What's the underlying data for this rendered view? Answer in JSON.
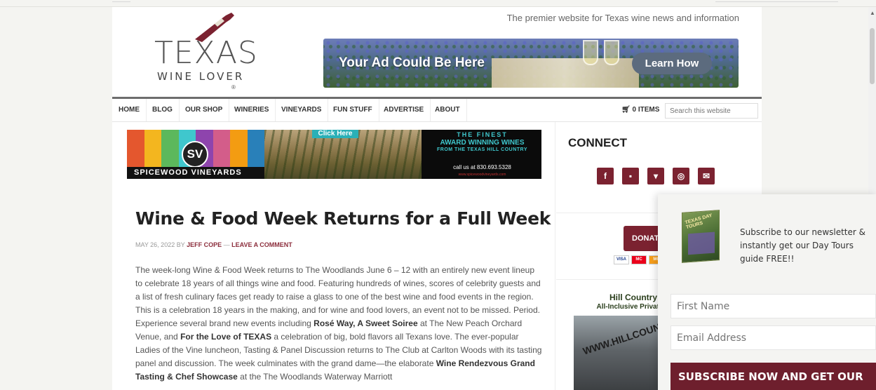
{
  "header": {
    "logo": {
      "line1": "TEXAS",
      "line2": "WINE LOVER",
      "reg": "®"
    },
    "tagline": "The premier website for Texas wine news and information",
    "ad": {
      "title": "Your Ad Could Be Here",
      "button": "Learn How"
    }
  },
  "nav": {
    "items": [
      "HOME",
      "BLOG",
      "OUR SHOP",
      "WINERIES",
      "VINEYARDS",
      "FUN STUFF",
      "ADVERTISE",
      "ABOUT"
    ],
    "cart_label": "0 ITEMS",
    "search_placeholder": "Search this website"
  },
  "sv_ad": {
    "logo": "SV",
    "name": "SPICEWOOD VINEYARDS",
    "click": "Click Here",
    "finest": "THE FINEST",
    "award": "AWARD WINNING WINES",
    "hill": "FROM THE TEXAS HILL COUNTRY",
    "call": "call us at 830.693.5328",
    "web": "www.spicewoodvineyards.com"
  },
  "post": {
    "title": "Wine & Food Week Returns for a Full Week",
    "date": "MAY 26, 2022",
    "by": "BY",
    "author": "JEFF COPE",
    "sep": "—",
    "comment": "LEAVE A COMMENT",
    "p1": "The week-long Wine & Food Week returns to The Woodlands June 6 – 12 with an entirely new event lineup to celebrate 18 years of all things wine and food. Featuring hundreds of wines, scores of celebrity guests and a list of fresh culinary faces get ready to raise a glass to one of the best wine and food events in the region. This is a celebration 18 years in the making, and for wine and food lovers, an event not to be missed. Period. Experience several brand new events including ",
    "b1": "Rosé Way, A Sweet Soiree",
    "p2": " at The New Peach Orchard Venue, and ",
    "b2": "For the Love of TEXAS",
    "p3": " a celebration of big, bold flavors all Texans love. The ever-popular Ladies of the Vine luncheon, Tasting & Panel Discussion returns to The Club at Carlton Woods with its tasting panel and discussion. The week culminates with the grand dame—the elaborate ",
    "b3": "Wine Rendezvous Grand Tasting & Chef Showcase",
    "p4": " at the The Woodlands Waterway Marriott"
  },
  "sidebar": {
    "connect": "CONNECT",
    "social": [
      {
        "icon": "facebook-icon",
        "glyph": "f"
      },
      {
        "icon": "facebook-square-icon",
        "glyph": "▪"
      },
      {
        "icon": "twitter-icon",
        "glyph": "▾"
      },
      {
        "icon": "instagram-icon",
        "glyph": "◎"
      },
      {
        "icon": "email-icon",
        "glyph": "✉"
      }
    ],
    "donate": "DONATE",
    "cards": [
      "VISA",
      "MC",
      "MC"
    ],
    "tour_ad": {
      "line1": "Hill Country",
      "line2": "All-Inclusive Private D",
      "van": "WWW.HILLCOUNTRY"
    }
  },
  "popup": {
    "book_title": "TEXAS DAY TOURS",
    "message": "Subscribe to our newsletter & instantly get our Day Tours guide FREE!!",
    "first_name": "First Name",
    "email": "Email Address",
    "button": "SUBSCRIBE NOW AND GET OUR"
  },
  "colors": {
    "accent": "#7b2230",
    "subscribe": "#6e1f2d",
    "sv_teal": "#3fc7cd"
  }
}
